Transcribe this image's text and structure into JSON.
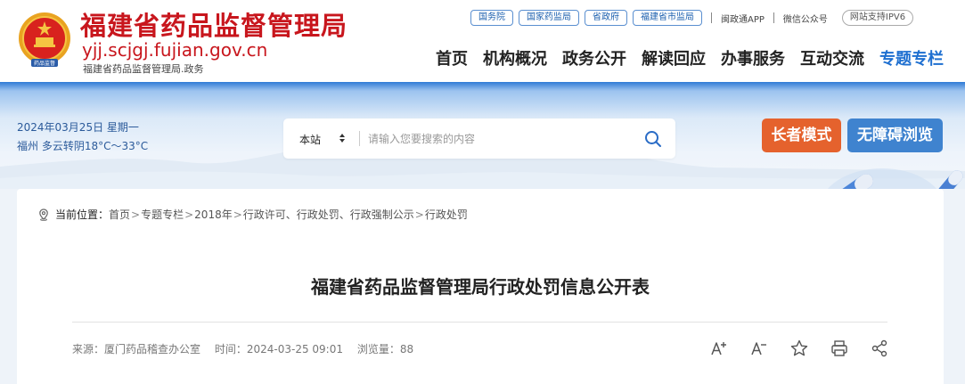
{
  "header": {
    "site_title": "福建省药品监督管理局",
    "site_domain": "yjj.scjgj.fujian.gov.cn",
    "site_subtitle": "福建省药品监督管理局.政务",
    "top_links": [
      "国务院",
      "国家药监局",
      "省政府",
      "福建省市监局"
    ],
    "app_link": "闽政通APP",
    "wechat_link": "微信公众号",
    "ipv6_badge": "网站支持IPV6",
    "emblem_icon": "national-emblem-icon"
  },
  "nav": {
    "items": [
      "首页",
      "机构概况",
      "政务公开",
      "解读回应",
      "办事服务",
      "互动交流",
      "专题专栏"
    ],
    "active": "专题专栏",
    "active_color": "#1e6fd0"
  },
  "banner": {
    "date": "2024年03月25日 星期一",
    "weather": "福州 多云转阴18°C～33°C",
    "search": {
      "scope": "本站",
      "placeholder": "请输入您要搜索的内容"
    },
    "elder_mode": "长者模式",
    "accessible": "无障碍浏览",
    "elder_color": "#e5622d",
    "accessible_color": "#3f83cf"
  },
  "breadcrumb": {
    "label": "当前位置：",
    "items": [
      "首页",
      "专题专栏",
      "2018年",
      "行政许可、行政处罚、行政强制公示",
      "行政处罚"
    ]
  },
  "article": {
    "title": "福建省药品监督管理局行政处罚信息公开表",
    "source": "来源：厦门药品稽查办公室",
    "time": "时间：2024-03-25 09:01",
    "views": "浏览量：88"
  },
  "colors": {
    "brand_red": "#c8161d"
  }
}
